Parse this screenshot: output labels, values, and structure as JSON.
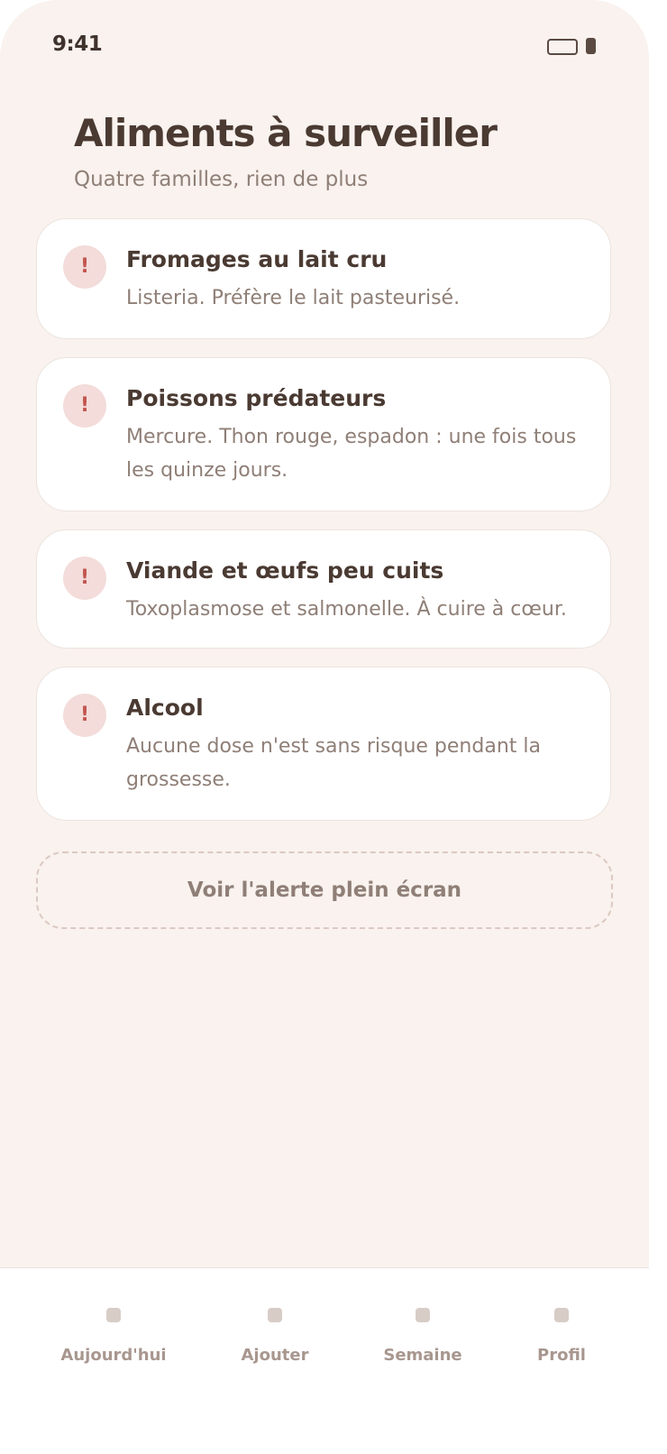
{
  "status_bar": {
    "time": "9:41",
    "icons": [
      "battery-outline-icon",
      "battery-icon"
    ]
  },
  "header": {
    "title": "Aliments à surveiller",
    "subtitle": "Quatre familles, rien de plus"
  },
  "cards": [
    {
      "icon": "alert-icon",
      "icon_glyph": "!",
      "title": "Fromages au lait cru",
      "description": "Listeria. Préfère le lait pasteurisé."
    },
    {
      "icon": "alert-icon",
      "icon_glyph": "!",
      "title": "Poissons prédateurs",
      "description": "Mercure. Thon rouge, espadon : une fois tous les quinze jours."
    },
    {
      "icon": "alert-icon",
      "icon_glyph": "!",
      "title": "Viande et œufs peu cuits",
      "description": "Toxoplasmose et salmonelle. À cuire à cœur."
    },
    {
      "icon": "alert-icon",
      "icon_glyph": "!",
      "title": "Alcool",
      "description": "Aucune dose n'est sans risque pendant la grossesse."
    }
  ],
  "fullscreen_button": {
    "label": "Voir l'alerte plein écran"
  },
  "tab_bar": {
    "tabs": [
      {
        "label": "Aujourd'hui",
        "icon": "today-icon"
      },
      {
        "label": "Ajouter",
        "icon": "add-icon"
      },
      {
        "label": "Semaine",
        "icon": "week-icon"
      },
      {
        "label": "Profil",
        "icon": "profile-icon"
      }
    ]
  },
  "colors": {
    "background": "#f9f2ee",
    "card": "#ffffff",
    "text_primary": "#4a3a32",
    "text_secondary": "#8f7f77",
    "alert_bg": "#f3dcda",
    "alert_fg": "#c2554e",
    "tab_label": "#a8978f"
  }
}
